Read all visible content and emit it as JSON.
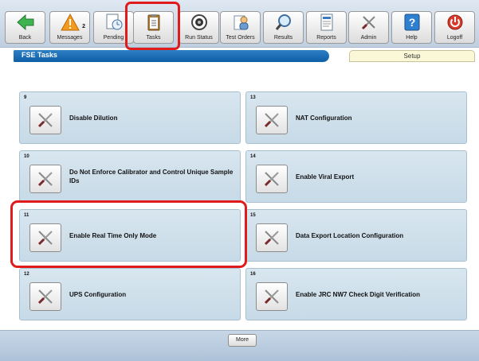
{
  "toolbar": {
    "buttons": [
      {
        "label": "Back",
        "icon": "back-arrow-icon",
        "badge": ""
      },
      {
        "label": "Messages",
        "icon": "warning-icon",
        "badge": "2"
      },
      {
        "label": "Pending",
        "icon": "pending-clock-icon",
        "badge": ""
      },
      {
        "label": "Tasks",
        "icon": "clipboard-icon",
        "badge": ""
      },
      {
        "label": "Run Status",
        "icon": "run-status-icon",
        "badge": ""
      },
      {
        "label": "Test Orders",
        "icon": "test-orders-icon",
        "badge": ""
      },
      {
        "label": "Results",
        "icon": "magnifier-icon",
        "badge": ""
      },
      {
        "label": "Reports",
        "icon": "report-icon",
        "badge": ""
      },
      {
        "label": "Admin",
        "icon": "tools-icon",
        "badge": ""
      },
      {
        "label": "Help",
        "icon": "help-icon",
        "badge": ""
      },
      {
        "label": "Logoff",
        "icon": "power-icon",
        "badge": ""
      }
    ]
  },
  "header": {
    "title": "FSE Tasks",
    "setup_tab": "Setup"
  },
  "tasks": [
    {
      "number": "9",
      "title": "Disable Dilution"
    },
    {
      "number": "13",
      "title": "NAT Configuration"
    },
    {
      "number": "10",
      "title": "Do Not Enforce Calibrator and Control Unique Sample IDs"
    },
    {
      "number": "14",
      "title": "Enable Viral Export"
    },
    {
      "number": "11",
      "title": "Enable Real Time Only Mode"
    },
    {
      "number": "15",
      "title": "Data Export Location Configuration"
    },
    {
      "number": "12",
      "title": "UPS Configuration"
    },
    {
      "number": "16",
      "title": "Enable JRC NW7 Check Digit Verification"
    }
  ],
  "footer": {
    "more_label": "More"
  },
  "colors": {
    "highlight": "#e01b1b",
    "title_bar": "#1565ad",
    "panel": "#cfe0eb"
  }
}
